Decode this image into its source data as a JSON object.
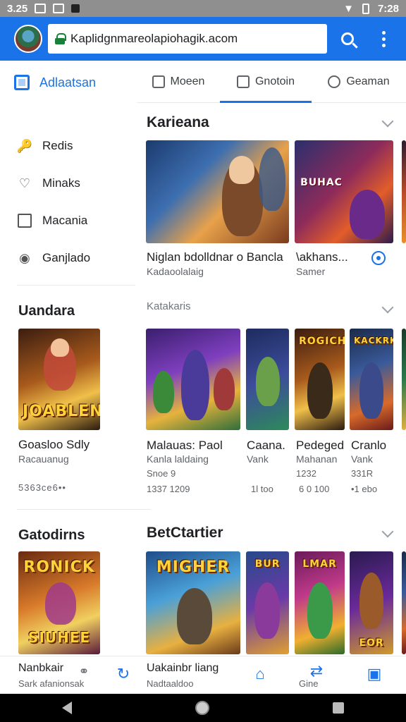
{
  "status_bar": {
    "time_left": "3.25",
    "time_right": "7:28"
  },
  "browser": {
    "url": "Kaplidgnmareolapiohagik.acom",
    "colors": {
      "bar": "#1a73e8",
      "accent": "#1a73e8"
    }
  },
  "sidebar": {
    "active_label": "Adlaatsan",
    "items": [
      {
        "label": "Redis",
        "icon": "key-icon"
      },
      {
        "label": "Minaks",
        "icon": "heart-icon"
      },
      {
        "label": "Macania",
        "icon": "box-icon"
      },
      {
        "label": "Ganjlado",
        "icon": "lock-icon"
      }
    ],
    "section1": {
      "heading": "Uandara",
      "cover_text": "JOABLEN",
      "title": "Goasloo Sdly",
      "subtitle": "Racauanug",
      "meta": "5363ce6••"
    },
    "section2": {
      "heading": "Gatodirns",
      "cover_text_top": "RONICK",
      "cover_text_bottom": "SIUHEE"
    }
  },
  "tabs": [
    {
      "label": "Moeen",
      "icon": "bookmark-icon"
    },
    {
      "label": "Gnotoin",
      "icon": "shopping-icon"
    },
    {
      "label": "Geaman",
      "icon": "shield-icon"
    }
  ],
  "main": {
    "section1": {
      "title": "Karieana",
      "cards": [
        {
          "title": "Niglan bdolldnar o Bancla",
          "subtitle": "Kadaoolalaig"
        },
        {
          "title": "\\akhans...",
          "subtitle": "Samer",
          "cover_text": "BUHAC"
        }
      ]
    },
    "section2": {
      "title": "Katakaris",
      "cards": [
        {
          "title": "Malauas: Paol",
          "subtitle": "Kanla laldaing",
          "meta1": "Snoe 9",
          "meta2": "1337 1209"
        },
        {
          "title": "Caana.",
          "subtitle": "Vank",
          "meta2": "1l  too"
        },
        {
          "title": "Pedeged",
          "subtitle": "Mahanan",
          "meta1": "1232",
          "meta2": "6 0  100",
          "cover_text": "ROGICH"
        },
        {
          "title": "Cranlo",
          "subtitle": "Vank",
          "meta1": "331R",
          "meta2": "•1 ebo",
          "cover_text": "KACKRK"
        }
      ]
    },
    "section3": {
      "title": "BetCtartier",
      "cards": [
        {
          "cover_text": "MIGHER"
        },
        {
          "cover_text": "BUR"
        },
        {
          "cover_text": "LMAR"
        },
        {
          "cover_text": "EOR"
        }
      ]
    }
  },
  "bottom_bar": {
    "left_title": "Nanbkair",
    "left_subtitle": "Sark afanionsak",
    "mid_title": "Uakainbr liang",
    "mid_subtitle": "Nadtaaldoo",
    "right_label": "Gine"
  }
}
